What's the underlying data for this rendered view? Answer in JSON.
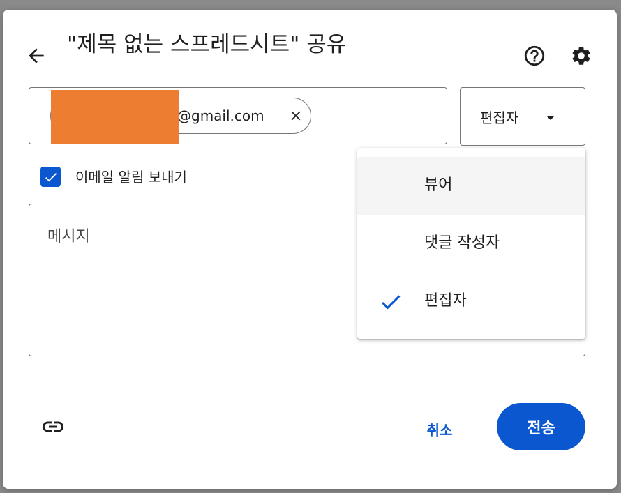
{
  "dialog": {
    "title": "\"제목 없는 스프레드시트\" 공유",
    "back_icon": "arrow-back-icon",
    "help_icon": "help-circle-icon",
    "settings_icon": "gear-icon"
  },
  "recipient": {
    "email_suffix": "@gmail.com",
    "remove_icon": "close-icon",
    "name_redacted": true
  },
  "role_select": {
    "selected": "편집자",
    "dropdown_icon": "caret-down-icon"
  },
  "notify": {
    "checked": true,
    "label": "이메일 알림 보내기"
  },
  "message": {
    "placeholder": "메시지"
  },
  "role_menu": {
    "items": [
      {
        "label": "뷰어",
        "selected": false,
        "hovered": true
      },
      {
        "label": "댓글 작성자",
        "selected": false,
        "hovered": false
      },
      {
        "label": "편집자",
        "selected": true,
        "hovered": false
      }
    ]
  },
  "footer": {
    "link_icon": "link-icon",
    "cancel_label": "취소",
    "send_label": "전송"
  },
  "colors": {
    "accent": "#0b57d0",
    "redaction": "#ed7d31"
  }
}
